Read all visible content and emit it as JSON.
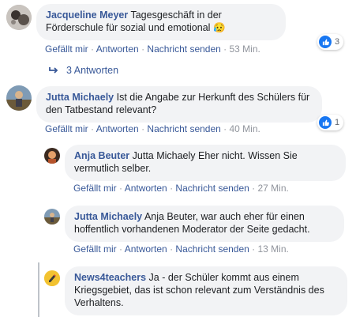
{
  "actions": {
    "like": "Gefällt mir",
    "reply": "Antworten",
    "message": "Nachricht senden",
    "sep": "·"
  },
  "replies_toggle": {
    "label": "3 Antworten"
  },
  "comments": [
    {
      "author": "Jacqueline Meyer",
      "text": "Tagesgeschäft in der Förderschule für sozial und emotional",
      "emoji": "😥",
      "time": "53 Min.",
      "reaction_count": "3"
    },
    {
      "author": "Jutta Michaely",
      "text": "Ist die Angabe zur Herkunft des Schülers für den Tatbestand relevant?",
      "time": "40 Min.",
      "reaction_count": "1"
    },
    {
      "author": "Anja Beuter",
      "text": "Jutta Michaely Eher nicht. Wissen Sie vermutlich selber.",
      "time": "27 Min."
    },
    {
      "author": "Jutta Michaely",
      "text": "Anja Beuter, war auch eher für einen hoffentlich vorhandenen Moderator der Seite gedacht.",
      "time": "13 Min."
    },
    {
      "author": "News4teachers",
      "text": "Ja - der Schüler kommt aus einem Kriegsgebiet, das ist schon relevant zum Verständnis des Verhaltens."
    }
  ],
  "colors": {
    "link": "#385898",
    "bubble": "#f2f3f5",
    "like_blue": "#1877f2"
  }
}
